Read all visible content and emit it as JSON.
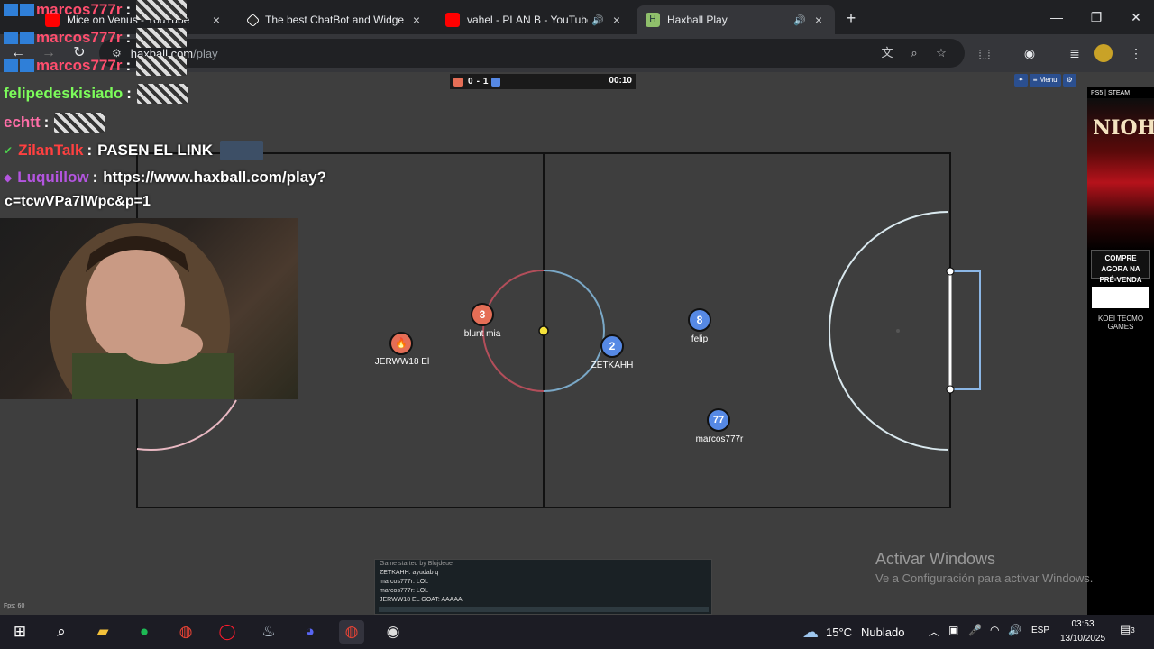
{
  "tabs": [
    {
      "title": "Mice on Venus - YouTube",
      "favicon_color": "#ff0000",
      "has_audio": false,
      "active": false
    },
    {
      "title": "The best ChatBot and Widgets",
      "favicon_color": "#ffffff",
      "has_audio": false,
      "active": false
    },
    {
      "title": "vahel - PLAN B - YouTube",
      "favicon_color": "#ff0000",
      "has_audio": true,
      "active": false
    },
    {
      "title": "Haxball Play",
      "favicon_color": "#8fbf6b",
      "has_audio": true,
      "active": true
    }
  ],
  "tab_icons": {
    "close": "×",
    "audio": "🔊",
    "new_tab": "+"
  },
  "window_controls": {
    "minimize": "—",
    "maximize": "❐",
    "close": "✕"
  },
  "address_bar": {
    "host": "haxball.com",
    "path": "/play"
  },
  "game": {
    "score_red": "0",
    "score_separator": "-",
    "score_blue": "1",
    "timer": "00:10",
    "red_color": "#e56e56",
    "blue_color": "#5689e5",
    "menu_button": "≡ Menu",
    "players": [
      {
        "name": "JERWW18 El",
        "number": "",
        "team": "red",
        "emoji": "🔥"
      },
      {
        "name": "blunt mia",
        "number": "3",
        "team": "red",
        "emoji": ""
      },
      {
        "name": "ZETKAHH",
        "number": "2",
        "team": "blue",
        "emoji": ""
      },
      {
        "name": "felip",
        "number": "8",
        "team": "blue",
        "emoji": ""
      },
      {
        "name": "marcos777r",
        "number": "77",
        "team": "blue",
        "emoji": ""
      }
    ],
    "fps": "Fps: 60",
    "chat_lines": [
      "Game started by Blujdeue",
      "ZETKAHH: ayudab q",
      "marcos777r: LOL",
      "marcos777r: LOL",
      "JERWW18 EL GOAT: AAAAA"
    ]
  },
  "ad": {
    "top": "PS5 | STEAM",
    "logo": "NIOH",
    "cta": "COMPRE AGORA NA PRÉ-VENDA",
    "brands": "KOEI TECMO GAMES"
  },
  "windows_activation": {
    "title": "Activar Windows",
    "subtitle": "Ve a Configuración para activar Windows."
  },
  "overlay_chat": [
    {
      "user": "marcos777r",
      "color": "#ff4e6e",
      "message": ""
    },
    {
      "user": "marcos777r",
      "color": "#ff4e6e",
      "message": ""
    },
    {
      "user": "marcos777r",
      "color": "#ff4e6e",
      "message": ""
    },
    {
      "user": "felipedeskisiado",
      "color": "#7cfc5a",
      "message": ""
    },
    {
      "user": "echtt",
      "color": "#ff6ea8",
      "message": ""
    },
    {
      "user": "ZilanTalk",
      "color": "#ff4040",
      "message": "PASEN EL LINK"
    },
    {
      "user": "Luquillow",
      "color": "#b455e0",
      "message": "https://www.haxball.com/play?"
    }
  ],
  "overlay_continuation": "c=tcwVPa7lWpc&p=1",
  "taskbar": {
    "weather_temp": "15°C",
    "weather_desc": "Nublado",
    "language": "ESP",
    "time": "03:53",
    "date": "13/10/2025",
    "notification_count": "3"
  }
}
